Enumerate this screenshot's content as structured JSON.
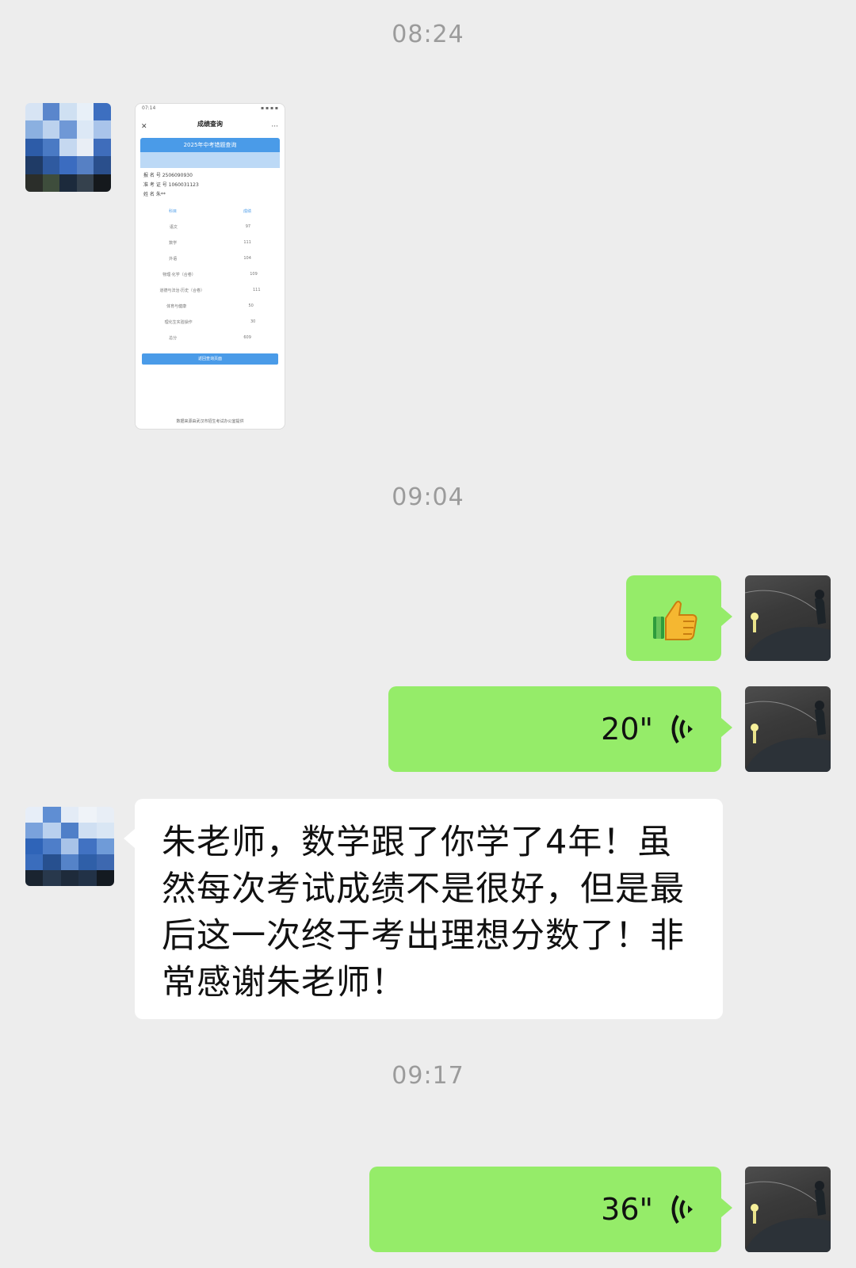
{
  "timestamps": [
    "08:24",
    "09:04",
    "09:17"
  ],
  "messages": {
    "voice_1": {
      "duration": "20\""
    },
    "text_1": {
      "text": "朱老师，数学跟了你学了4年！虽然每次考试成绩不是很好，但是最后这一次终于考出理想分数了！非常感谢朱老师！"
    },
    "voice_2": {
      "duration": "36\""
    }
  },
  "thumbnail": {
    "status_time": "07:14",
    "nav_title": "成绩查询",
    "nav_subtitle": "",
    "banner": "2025年中考错题查询",
    "info_rows": [
      "报  名  号  2506090930",
      "准 考 证 号  1060031123",
      "姓      名  朱**"
    ],
    "table_head": [
      "科目",
      "成绩"
    ],
    "table_rows": [
      [
        "语文",
        "97"
      ],
      [
        "数学",
        "111"
      ],
      [
        "外语",
        "104"
      ],
      [
        "物理·化学（合卷）",
        "109"
      ],
      [
        "道德与法治·历史（合卷）",
        "111"
      ],
      [
        "体育与健康",
        "50"
      ],
      [
        "理化生实验操作",
        "30"
      ],
      [
        "总分",
        "609"
      ]
    ],
    "button": "返回查询页面",
    "footer": "数据来源由武汉市招生考试办公室提供"
  },
  "colors": {
    "self_bubble": "#95ec69",
    "other_bubble": "#ffffff",
    "background": "#ededed"
  }
}
